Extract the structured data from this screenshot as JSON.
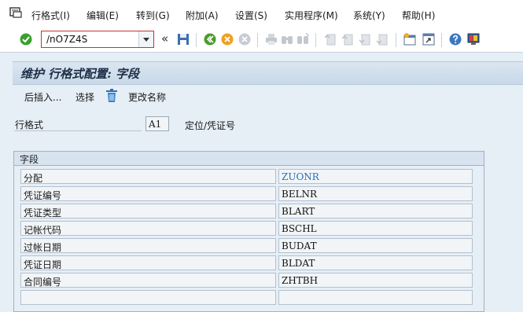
{
  "menubar": {
    "items": [
      "行格式(I)",
      "编辑(E)",
      "转到(G)",
      "附加(A)",
      "设置(S)",
      "实用程序(M)",
      "系统(Y)",
      "帮助(H)"
    ]
  },
  "toolbar": {
    "command_value": "/nO7Z4S",
    "back_arrows": "«",
    "icons": [
      "enter-check",
      "save",
      "back",
      "exit",
      "cancel",
      "print",
      "find",
      "find-next",
      "first-page",
      "previous-page",
      "next-page",
      "last-page",
      "create-session",
      "shortcut",
      "help",
      "customize-layout"
    ]
  },
  "title": {
    "text": "维护 行格式配置: 字段"
  },
  "app_toolbar": {
    "insert_after": "后插入...",
    "select": "选择",
    "rename": "更改名称"
  },
  "header": {
    "label": "行格式",
    "value": "A1",
    "description": "定位/凭证号"
  },
  "group": {
    "title": "字段",
    "rows": [
      {
        "label": "分配",
        "value": "ZUONR"
      },
      {
        "label": "凭证编号",
        "value": "BELNR"
      },
      {
        "label": "凭证类型",
        "value": "BLART"
      },
      {
        "label": "记帐代码",
        "value": "BSCHL"
      },
      {
        "label": "过帐日期",
        "value": "BUDAT"
      },
      {
        "label": "凭证日期",
        "value": "BLDAT"
      },
      {
        "label": "合同编号",
        "value": "ZHTBH"
      },
      {
        "label": "",
        "value": ""
      }
    ]
  },
  "colors": {
    "background": "#e6eef6",
    "focus_text": "#2a6db8",
    "command_border": "#c83232",
    "confirm_green": "#3aa02c"
  }
}
